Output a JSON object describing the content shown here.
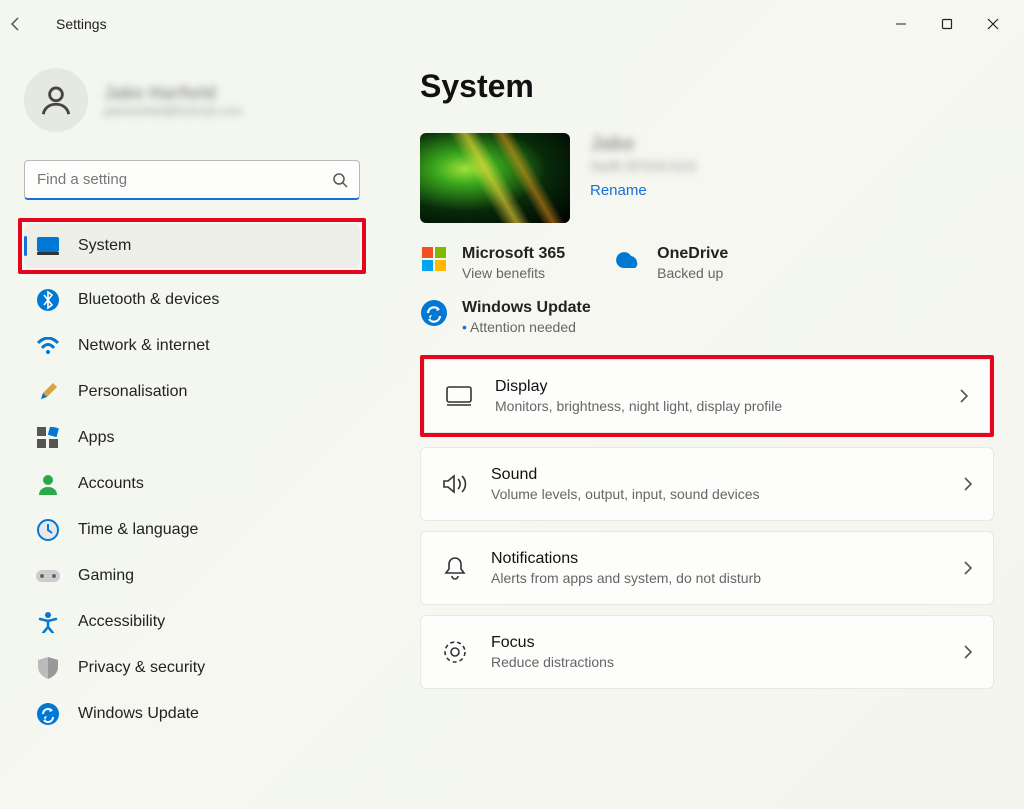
{
  "window": {
    "title": "Settings"
  },
  "profile": {
    "name": "Jake Harfield",
    "email": "jakeharfield@hotmail.com"
  },
  "search": {
    "placeholder": "Find a setting"
  },
  "nav": [
    {
      "id": "system",
      "label": "System",
      "selected": true
    },
    {
      "id": "bluetooth",
      "label": "Bluetooth & devices"
    },
    {
      "id": "network",
      "label": "Network & internet"
    },
    {
      "id": "personalisation",
      "label": "Personalisation"
    },
    {
      "id": "apps",
      "label": "Apps"
    },
    {
      "id": "accounts",
      "label": "Accounts"
    },
    {
      "id": "time",
      "label": "Time & language"
    },
    {
      "id": "gaming",
      "label": "Gaming"
    },
    {
      "id": "accessibility",
      "label": "Accessibility"
    },
    {
      "id": "privacy",
      "label": "Privacy & security"
    },
    {
      "id": "update",
      "label": "Windows Update"
    }
  ],
  "page": {
    "title": "System",
    "device_name": "Jake",
    "device_model": "Swift SF316-51G",
    "rename": "Rename"
  },
  "status": {
    "ms365": {
      "title": "Microsoft 365",
      "sub": "View benefits"
    },
    "onedrive": {
      "title": "OneDrive",
      "sub": "Backed up"
    },
    "update": {
      "title": "Windows Update",
      "sub": "Attention needed"
    }
  },
  "settings": [
    {
      "id": "display",
      "title": "Display",
      "sub": "Monitors, brightness, night light, display profile",
      "highlight": true
    },
    {
      "id": "sound",
      "title": "Sound",
      "sub": "Volume levels, output, input, sound devices"
    },
    {
      "id": "notifications",
      "title": "Notifications",
      "sub": "Alerts from apps and system, do not disturb"
    },
    {
      "id": "focus",
      "title": "Focus",
      "sub": "Reduce distractions"
    }
  ]
}
